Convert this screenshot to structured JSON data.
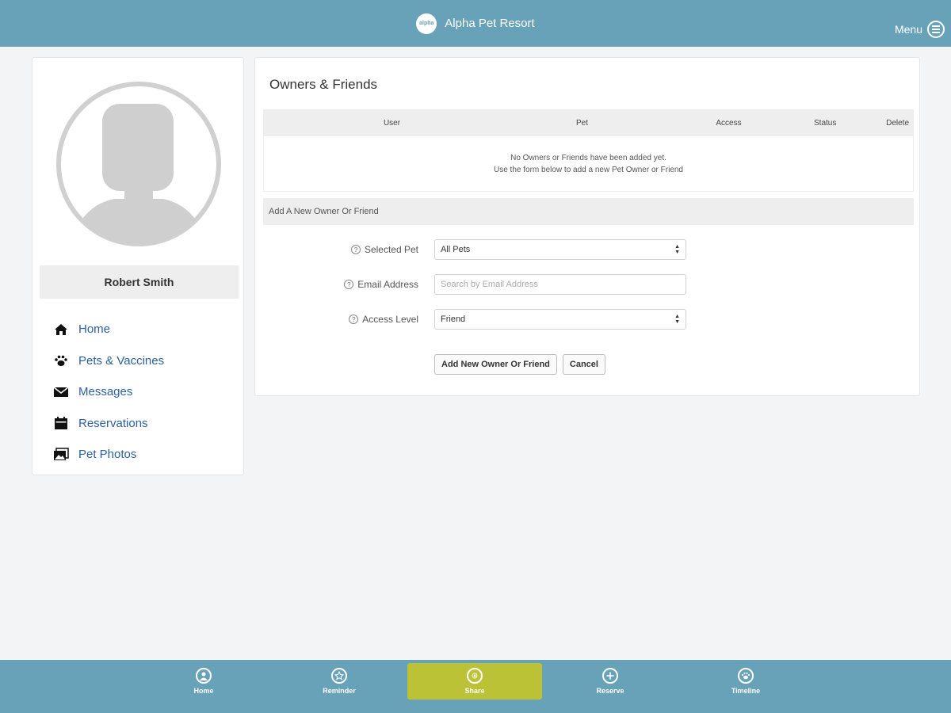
{
  "header": {
    "logo_text": "alpha",
    "title": "Alpha Pet Resort",
    "menu_label": "Menu"
  },
  "sidebar": {
    "user_name": "Robert Smith",
    "items": [
      {
        "label": "Home",
        "icon": "home-icon"
      },
      {
        "label": "Pets & Vaccines",
        "icon": "paw-icon"
      },
      {
        "label": "Messages",
        "icon": "envelope-icon"
      },
      {
        "label": "Reservations",
        "icon": "calendar-icon"
      },
      {
        "label": "Pet Photos",
        "icon": "photos-icon"
      }
    ]
  },
  "main": {
    "title": "Owners & Friends",
    "table": {
      "columns": [
        "User",
        "Pet",
        "Access",
        "Status",
        "Delete"
      ],
      "empty_line1": "No Owners or Friends have been added yet.",
      "empty_line2": "Use the form below to add a new Pet Owner or Friend"
    },
    "form": {
      "section_title": "Add A New Owner Or Friend",
      "selected_pet_label": "Selected Pet",
      "selected_pet_value": "All Pets",
      "email_label": "Email Address",
      "email_placeholder": "Search by Email Address",
      "access_label": "Access Level",
      "access_value": "Friend",
      "add_button": "Add New Owner Or Friend",
      "cancel_button": "Cancel"
    }
  },
  "bottom_nav": {
    "items": [
      {
        "label": "Home",
        "icon": "user-circle-icon",
        "active": false
      },
      {
        "label": "Reminder",
        "icon": "star-icon",
        "active": false
      },
      {
        "label": "Share",
        "icon": "share-icon",
        "active": true
      },
      {
        "label": "Reserve",
        "icon": "plus-circle-icon",
        "active": false
      },
      {
        "label": "Timeline",
        "icon": "paw-circle-icon",
        "active": false
      }
    ]
  },
  "colors": {
    "header_bg": "#67a2b8",
    "active_tab": "#bcc236",
    "link": "#2c5fa0"
  }
}
